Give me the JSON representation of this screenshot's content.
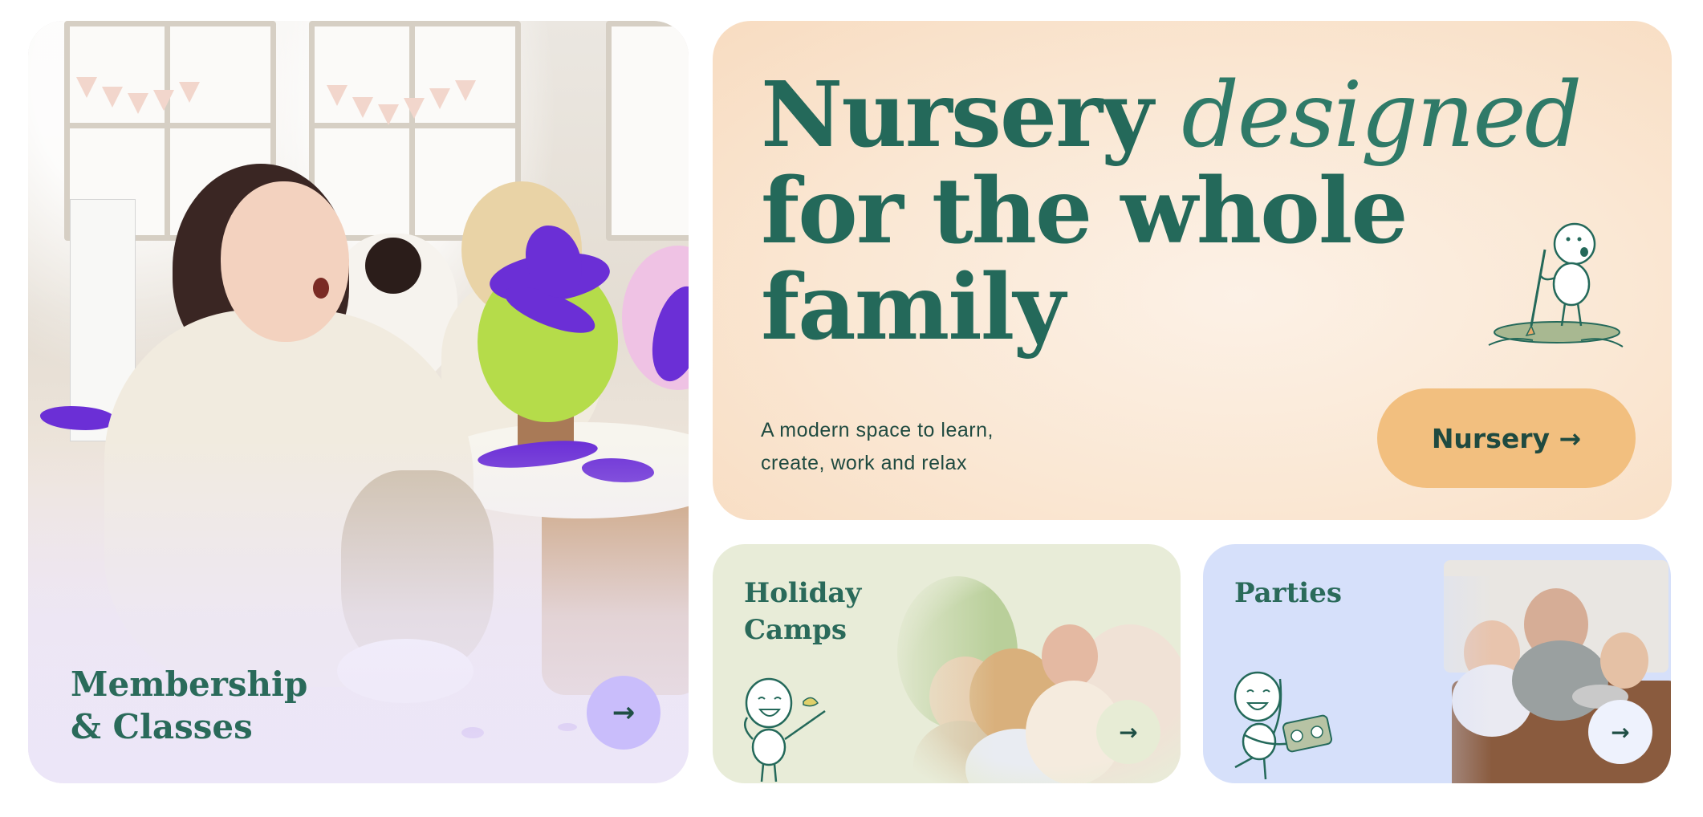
{
  "cards": {
    "membership": {
      "title": "Membership & Classes",
      "title_line1": "Membership",
      "title_line2": "& Classes",
      "button_icon": "arrow-right-icon",
      "button_glyph": "→",
      "accent": "#c9bdfb"
    },
    "hero": {
      "title_word1": "Nursery",
      "title_word2": "designed",
      "title_line2": "for the whole",
      "title_line3": "family",
      "description_line1": "A modern space to learn,",
      "description_line2": "create, work and relax",
      "button_label": "Nursery",
      "button_icon": "arrow-right-icon",
      "button_glyph": "→",
      "button_color": "#f2bf7f",
      "background": "#fae7d3"
    },
    "camps": {
      "title_line1": "Holiday",
      "title_line2": "Camps",
      "button_icon": "arrow-right-icon",
      "button_glyph": "→",
      "background": "#e8ecd8"
    },
    "parties": {
      "title": "Parties",
      "button_icon": "arrow-right-icon",
      "button_glyph": "→",
      "background": "#d6e0fa"
    }
  },
  "colors": {
    "heading_green": "#24695a",
    "text_dark": "#1f4a40"
  }
}
